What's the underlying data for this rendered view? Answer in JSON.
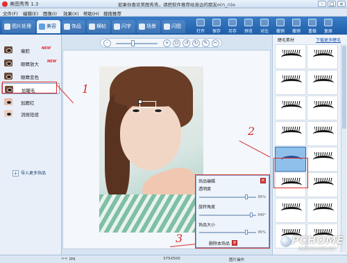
{
  "titlebar": {
    "app_title": "美图秀秀 1.3",
    "notice": "如果你喜欢美图秀秀，请把软件推荐给身边的朋友o(∩_∩)o",
    "min": "-",
    "max": "□",
    "close": "×"
  },
  "menu": [
    "文件(F)",
    "编辑(E)",
    "图像(I)",
    "效果(X)",
    "帮助(H)",
    "搜搜推荐"
  ],
  "tabs": [
    {
      "label": "图片处理",
      "state": "dim"
    },
    {
      "label": "美容",
      "state": "active"
    },
    {
      "label": "饰品",
      "state": "dim"
    },
    {
      "label": "横帖",
      "state": "dim"
    },
    {
      "label": "闪字",
      "state": "dim"
    },
    {
      "label": "场景",
      "state": "dim"
    },
    {
      "label": "闪图",
      "state": "dim"
    }
  ],
  "toolbar_buttons": [
    "打开",
    "保存",
    "另存",
    "预览",
    "对比",
    "撤销",
    "撤销",
    "重做",
    "复原"
  ],
  "left_panel": {
    "items": [
      {
        "label": "瘦脸",
        "badge": "NEW"
      },
      {
        "label": "眼睛放大",
        "badge": "NEW"
      },
      {
        "label": "眼睛变色",
        "badge": ""
      },
      {
        "label": "加睫毛",
        "badge": ""
      },
      {
        "label": "加腮红",
        "badge": ""
      },
      {
        "label": "消斑祛痘",
        "badge": ""
      }
    ],
    "import_label": "导入更多饰品"
  },
  "canvas_toolbar": {
    "zoom_out": "-",
    "zoom_in": "+",
    "fit": "⊡",
    "rotate_left": "↺",
    "rotate_right": "↻",
    "edit": "✎",
    "tool": "✂"
  },
  "annotations": {
    "one": "1",
    "two": "2",
    "three": "3"
  },
  "sticker_editor": {
    "title": "饰品编辑",
    "close": "×",
    "opacity_label": "透明度",
    "opacity_value": "85%",
    "rotation_label": "旋转角度",
    "rotation_value": "340°",
    "size_label": "饰品大小",
    "size_value": "85%",
    "opacity_fraction": 0.85,
    "rotation_fraction": 0.94,
    "size_fraction": 0.85,
    "delete_label": "删除本饰品",
    "delete_x": "×"
  },
  "right_panel": {
    "title": "睫毛素材",
    "download_link": "下载更多睫毛",
    "selected_index": 8
  },
  "statusbar": {
    "prev": "<<",
    "filename": "jpg",
    "size": "375X500",
    "action": "图片操作"
  },
  "watermark": {
    "main": "PCHOME",
    "sub": "WWW.PCHOME.NET"
  }
}
